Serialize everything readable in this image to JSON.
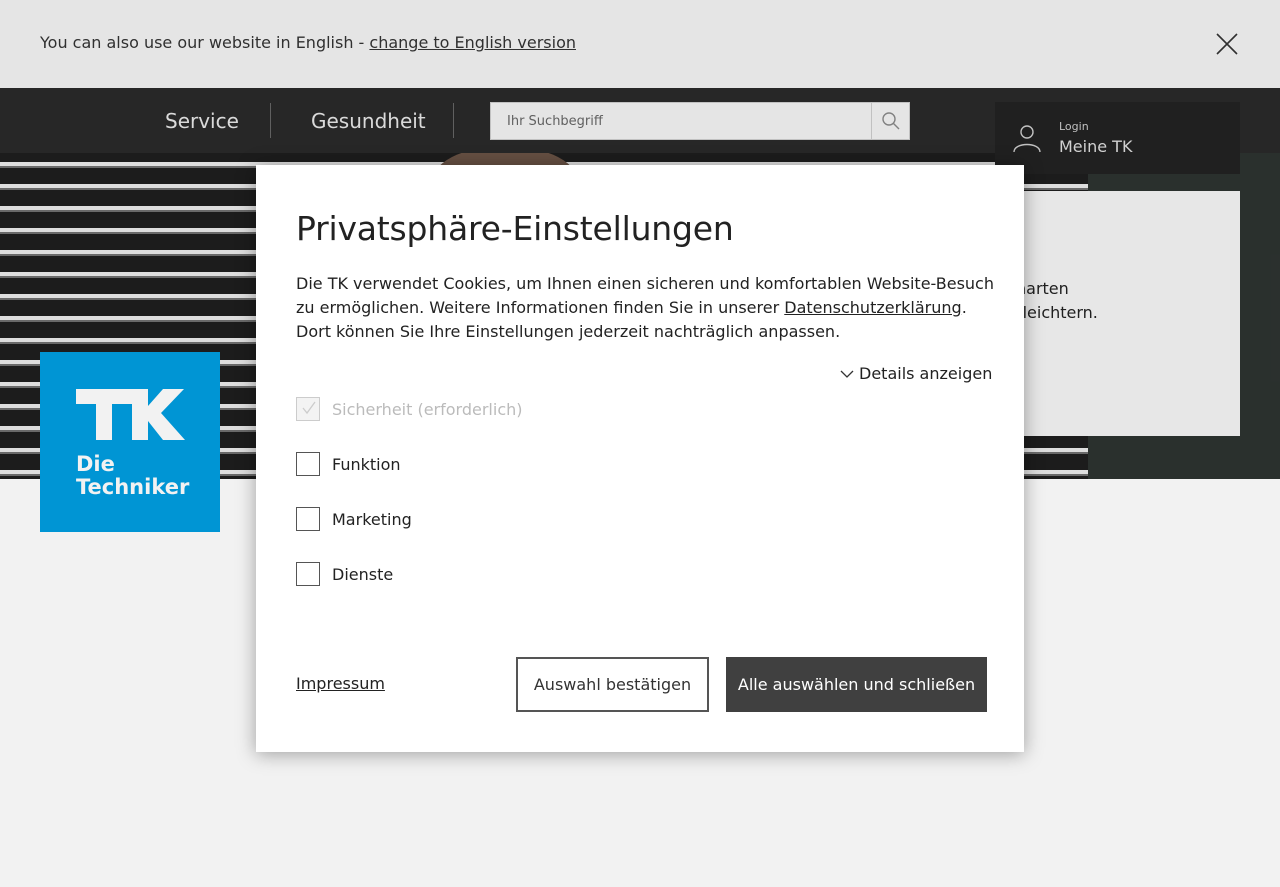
{
  "language_bar": {
    "text": "You can also use our website in English - ",
    "link": "change to English version",
    "close_icon": "close-icon"
  },
  "nav": {
    "items": [
      "Service",
      "Gesundheit"
    ],
    "search_placeholder": "Ihr Suchbegriff",
    "search_icon": "search-icon"
  },
  "login": {
    "small_label": "Login",
    "title": "Meine TK",
    "icon": "user-icon"
  },
  "teaser": {
    "line1": "harten",
    "line2": "rleichtern."
  },
  "logo": {
    "line1": "Die",
    "line2": "Techniker",
    "color": "#009ee0"
  },
  "modal": {
    "title": "Privatsphäre-Einstellungen",
    "desc_before": "Die TK verwendet Cookies, um Ihnen einen sicheren und komfortablen Website-Besuch zu ermöglichen. Weitere Informationen finden Sie in unserer ",
    "desc_link": "Datenschutzerklärung",
    "desc_after": ". Dort können Sie Ihre Einstellungen jederzeit nachträglich anpassen.",
    "details_label": "Details anzeigen",
    "options": [
      {
        "label": "Sicherheit (erforderlich)",
        "checked": true,
        "disabled": true
      },
      {
        "label": "Funktion",
        "checked": false,
        "disabled": false
      },
      {
        "label": "Marketing",
        "checked": false,
        "disabled": false
      },
      {
        "label": "Dienste",
        "checked": false,
        "disabled": false
      }
    ],
    "impressum": "Impressum",
    "confirm_button": "Auswahl bestätigen",
    "accept_all_button": "Alle auswählen und schließen"
  },
  "colors": {
    "brand": "#009ee0",
    "primary_button": "#404040"
  }
}
